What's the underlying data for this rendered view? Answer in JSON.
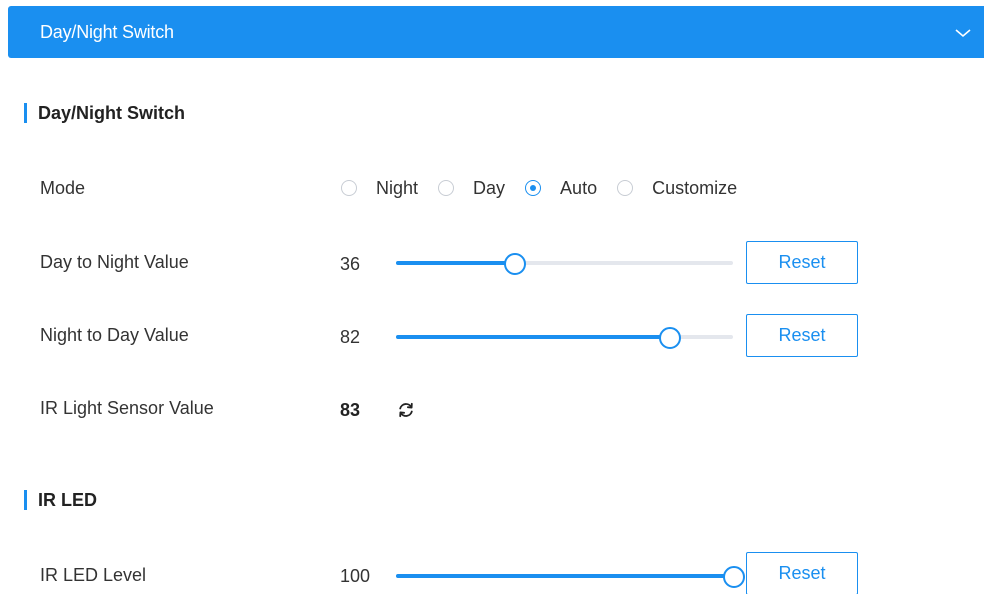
{
  "header": {
    "title": "Day/Night Switch",
    "icon": "chevron-down-icon",
    "color": "#1a8ff0"
  },
  "day_night_section": {
    "title": "Day/Night Switch",
    "mode": {
      "label": "Mode",
      "options": [
        "Night",
        "Day",
        "Auto",
        "Customize"
      ],
      "selected": "Auto"
    },
    "day_to_night": {
      "label": "Day to Night Value",
      "value": "36",
      "slider_percent": 35,
      "reset_label": "Reset"
    },
    "night_to_day": {
      "label": "Night to Day Value",
      "value": "82",
      "slider_percent": 81,
      "reset_label": "Reset"
    },
    "ir_sensor": {
      "label": "IR Light Sensor Value",
      "value": "83",
      "icon": "refresh-icon"
    }
  },
  "ir_led_section": {
    "title": "IR LED",
    "level": {
      "label": "IR LED Level",
      "value": "100",
      "slider_percent": 100,
      "reset_label": "Reset"
    }
  },
  "colors": {
    "accent": "#1a8ff0",
    "rail": "#e4e7ed",
    "text": "#333333"
  }
}
